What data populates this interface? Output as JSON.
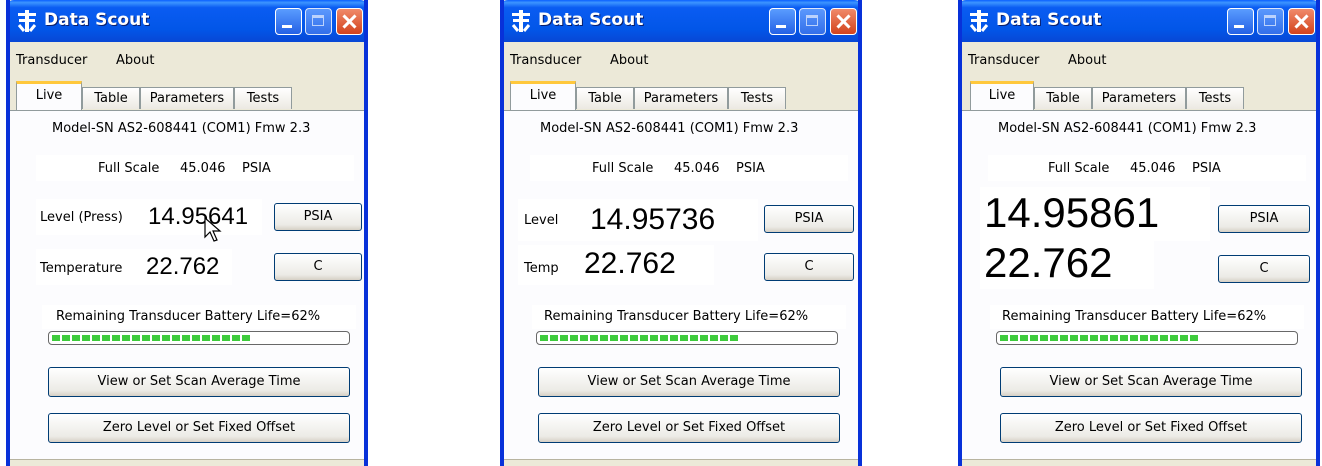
{
  "app": {
    "title": "Data Scout",
    "icon": "ysi-logo-icon"
  },
  "menu": {
    "transducer": "Transducer",
    "about": "About"
  },
  "tabs": {
    "live": "Live",
    "table": "Table",
    "parameters": "Parameters",
    "tests": "Tests"
  },
  "model_info": "Model-SN AS2-608441 (COM1) Fmw 2.3",
  "full_scale": {
    "label": "Full Scale",
    "value": "45.046",
    "unit": "PSIA"
  },
  "battery": {
    "text": "Remaining Transducer Battery Life=62%",
    "percent": 62,
    "color": "#3ecb3c"
  },
  "buttons": {
    "scan_average": "View or Set Scan Average Time",
    "zero_level": "Zero Level or Set Fixed Offset"
  },
  "windows": [
    {
      "level_label": "Level (Press)",
      "level_value": "14.95641",
      "level_unit": "PSIA",
      "temp_label": "Temperature",
      "temp_value": "22.762",
      "temp_unit": "C"
    },
    {
      "level_label": "Level",
      "level_value": "14.95736",
      "level_unit": "PSIA",
      "temp_label": "Temp",
      "temp_value": "22.762",
      "temp_unit": "C"
    },
    {
      "level_value": "14.95861",
      "level_unit": "PSIA",
      "temp_value": "22.762",
      "temp_unit": "C"
    }
  ],
  "colors": {
    "titlebar": "#0256e8",
    "tab_highlight": "#ffc83c",
    "window_bg": "#ece9d8"
  }
}
